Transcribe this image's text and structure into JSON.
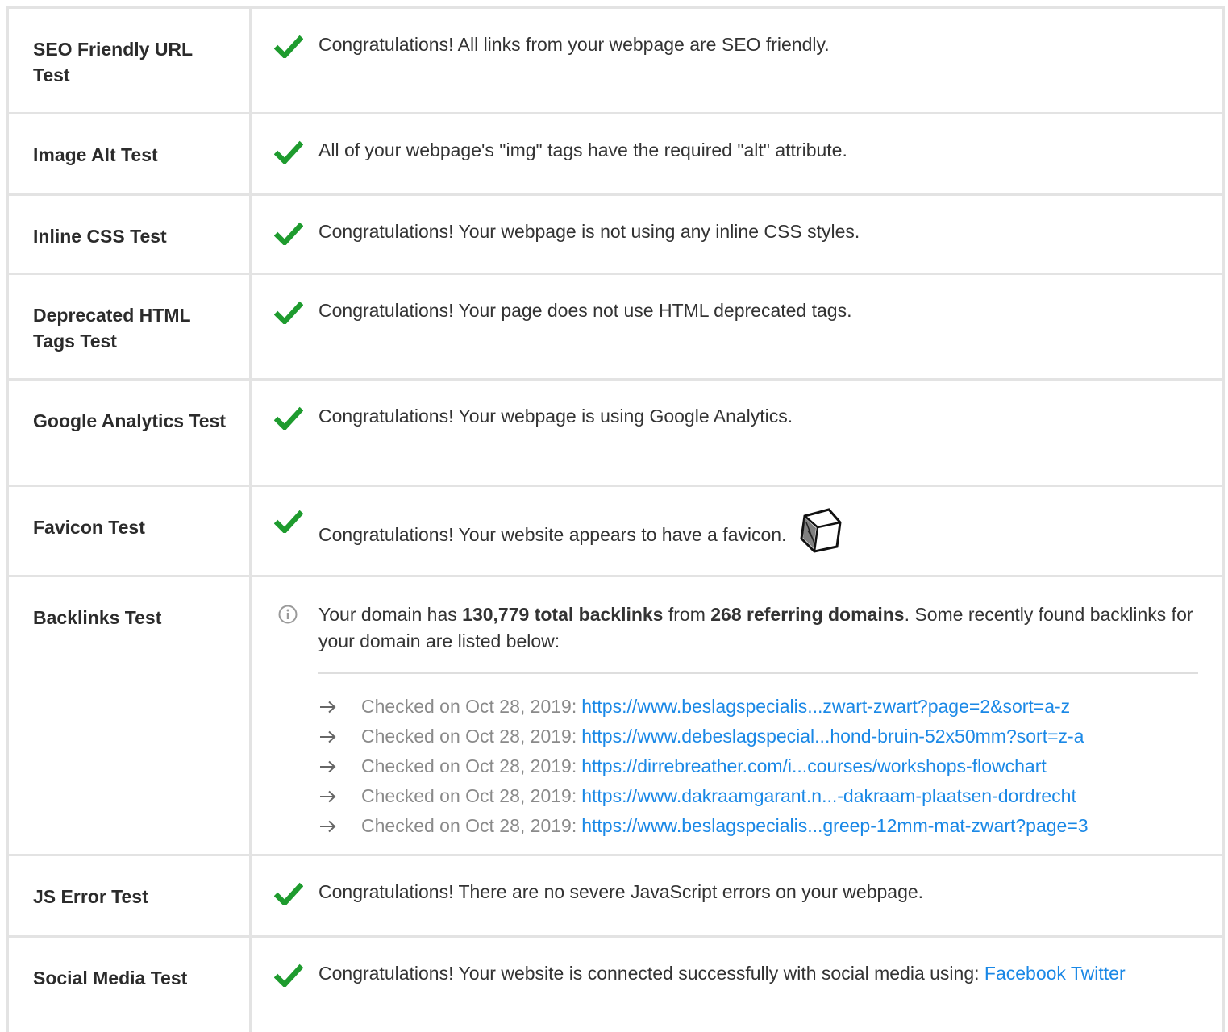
{
  "colors": {
    "check": "#1e9b2e",
    "link": "#1a88e6",
    "border": "#e3e3e3",
    "muted": "#8a8a8a"
  },
  "rows": [
    {
      "name": "SEO Friendly URL Test",
      "icon": "check-icon",
      "message": "Congratulations! All links from your webpage are SEO friendly."
    },
    {
      "name": "Image Alt Test",
      "icon": "check-icon",
      "message": "All of your webpage's \"img\" tags have the required \"alt\" attribute."
    },
    {
      "name": "Inline CSS Test",
      "icon": "check-icon",
      "message": "Congratulations! Your webpage is not using any inline CSS styles."
    },
    {
      "name": "Deprecated HTML Tags Test",
      "icon": "check-icon",
      "message": "Congratulations! Your page does not use HTML deprecated tags."
    },
    {
      "name": "Google Analytics Test",
      "icon": "check-icon",
      "message": "Congratulations! Your webpage is using Google Analytics."
    },
    {
      "name": "Favicon Test",
      "icon": "check-icon",
      "message": "Congratulations! Your website appears to have a favicon.",
      "favicon_icon": "cube-favicon-icon"
    },
    {
      "name": "Backlinks Test",
      "icon": "info-icon",
      "message_parts": {
        "prefix": "Your domain has ",
        "backlinks": "130,779 total backlinks",
        "middle": " from ",
        "domains": "268 referring domains",
        "suffix": ". Some recently found backlinks for your domain are listed below:"
      },
      "backlinks": [
        {
          "checked": "Checked on Oct 28, 2019:",
          "url": "https://www.beslagspecialis...zwart-zwart?page=2&sort=a-z"
        },
        {
          "checked": "Checked on Oct 28, 2019:",
          "url": "https://www.debeslagspecial...hond-bruin-52x50mm?sort=z-a"
        },
        {
          "checked": "Checked on Oct 28, 2019:",
          "url": "https://dirrebreather.com/i...courses/workshops-flowchart"
        },
        {
          "checked": "Checked on Oct 28, 2019:",
          "url": "https://www.dakraamgarant.n...-dakraam-plaatsen-dordrecht"
        },
        {
          "checked": "Checked on Oct 28, 2019:",
          "url": "https://www.beslagspecialis...greep-12mm-mat-zwart?page=3"
        }
      ]
    },
    {
      "name": "JS Error Test",
      "icon": "check-icon",
      "message": "Congratulations! There are no severe JavaScript errors on your webpage."
    },
    {
      "name": "Social Media Test",
      "icon": "check-icon",
      "message": "Congratulations! Your website is connected successfully with social media using: ",
      "links": [
        "Facebook",
        "Twitter"
      ]
    }
  ]
}
